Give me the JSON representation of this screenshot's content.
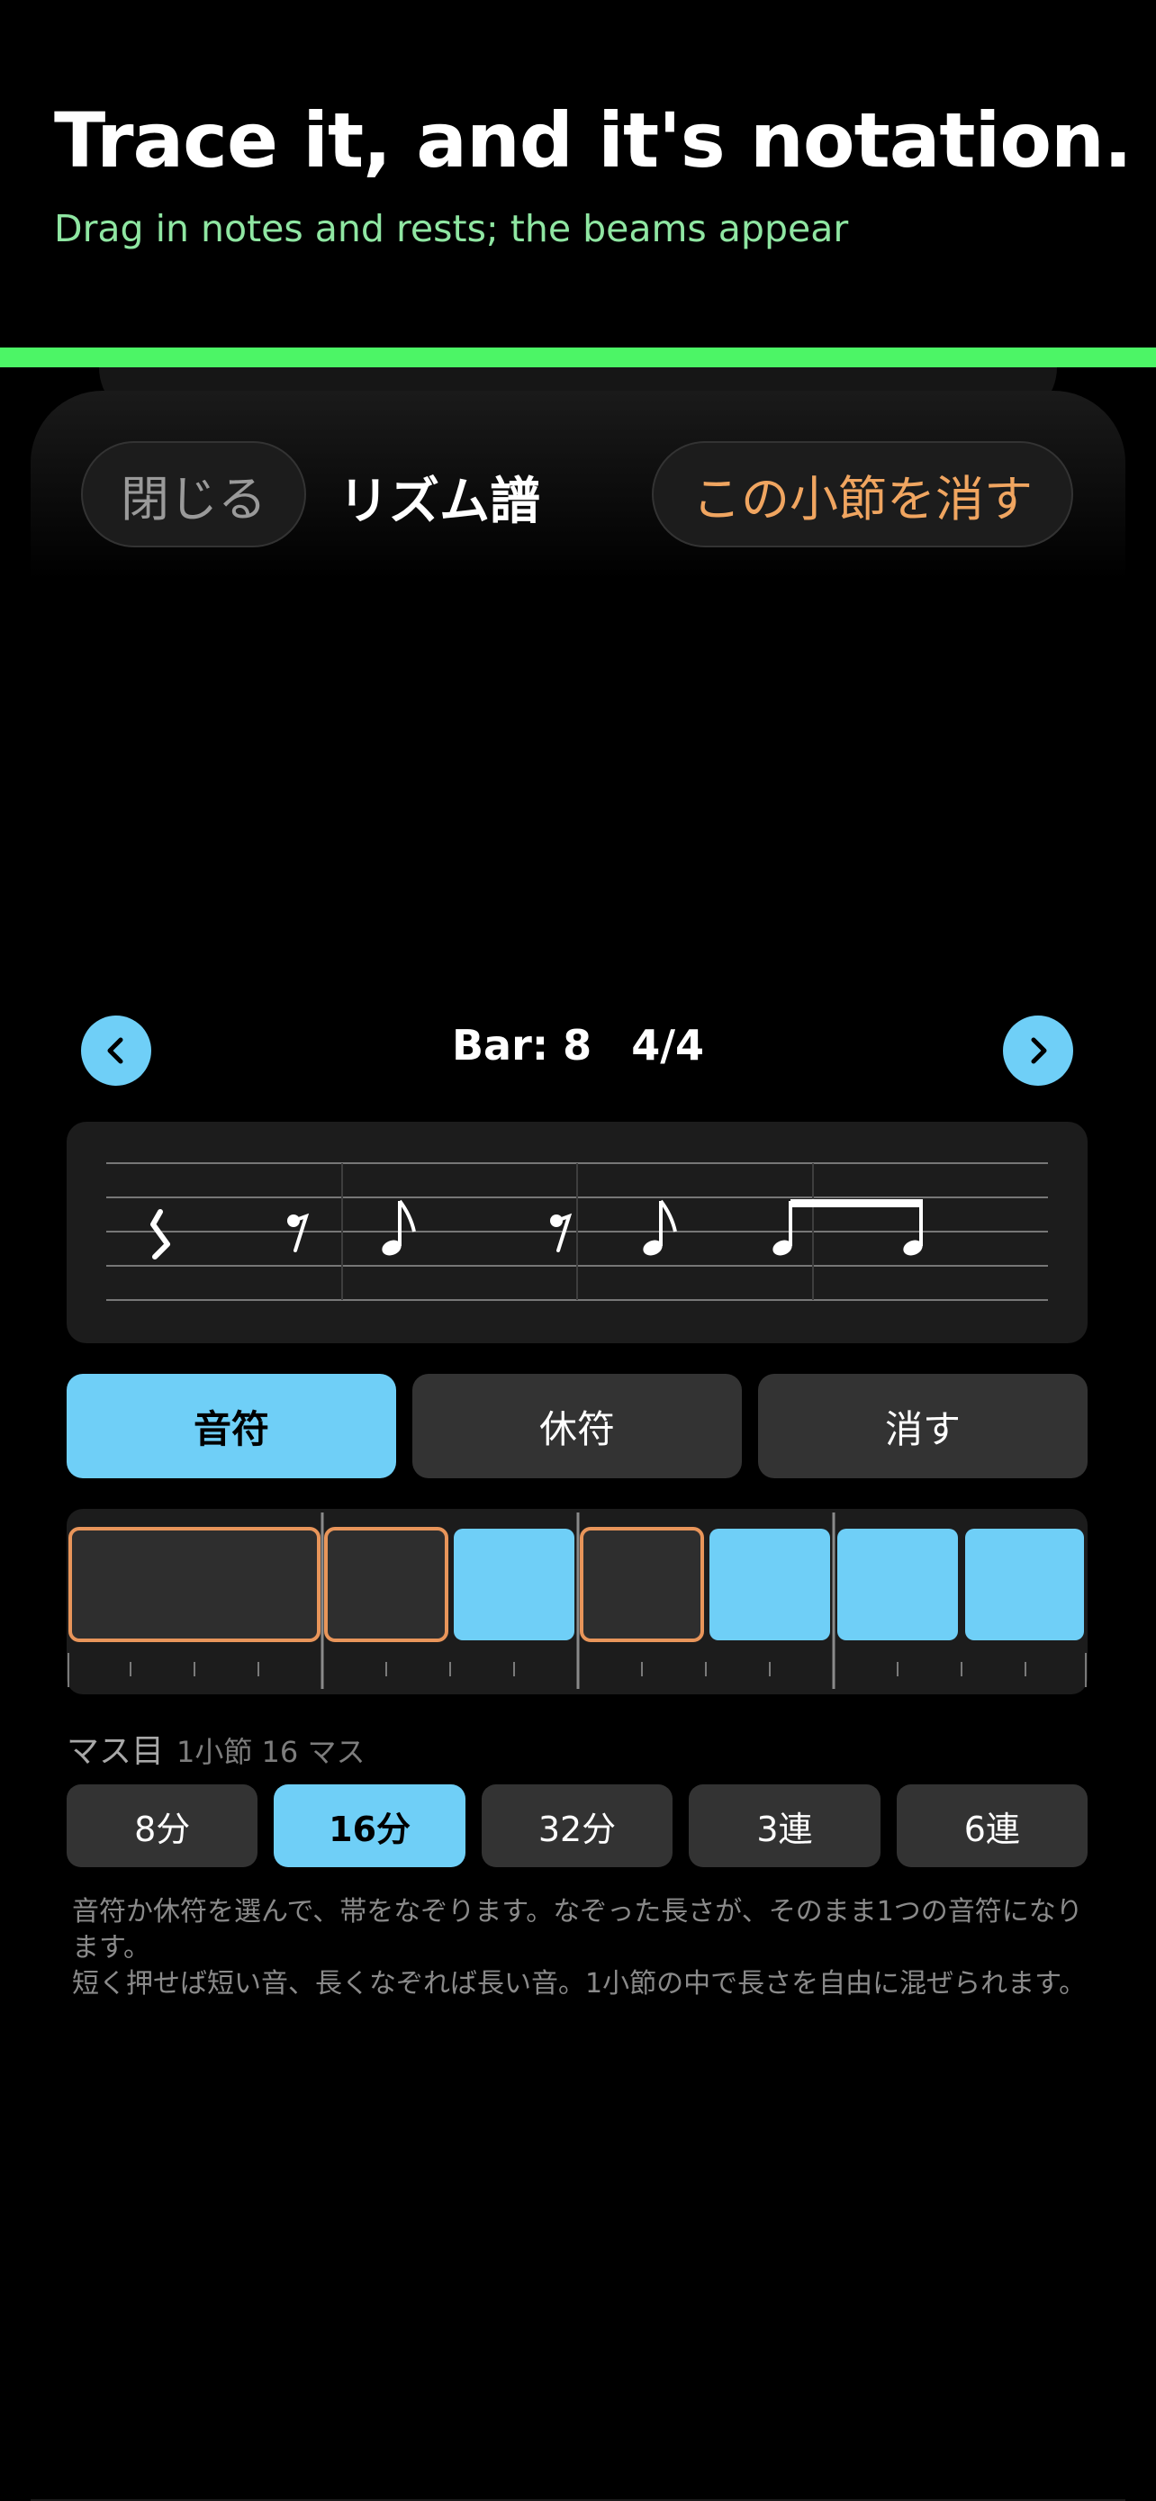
{
  "hero": {
    "title": "Trace it, and it's notation.",
    "subtitle": "Drag in notes and rests; the beams appear"
  },
  "header": {
    "close_label": "閉じる",
    "title": "リズム譜",
    "clear_label": "この小節を消す"
  },
  "bar_nav": {
    "bar_text": "Bar: 8",
    "time_signature": "4/4",
    "prev_icon": "chevron-left-icon",
    "next_icon": "chevron-right-icon"
  },
  "staff": {
    "events": [
      "quarter-rest",
      "eighth-rest",
      "eighth-note",
      "eighth-rest",
      "eighth-note",
      "beamed-eighth-pair"
    ]
  },
  "modes": [
    {
      "label": "音符",
      "active": true
    },
    {
      "label": "休符",
      "active": false
    },
    {
      "label": "消す",
      "active": false
    }
  ],
  "grid": {
    "caption": "マス目",
    "caption_sub": "1小節 16 マス",
    "steps_per_bar": 16,
    "cells": [
      {
        "type": "rest",
        "span": 4
      },
      {
        "type": "rest",
        "span": 2
      },
      {
        "type": "note",
        "span": 2
      },
      {
        "type": "rest",
        "span": 2
      },
      {
        "type": "note",
        "span": 2
      },
      {
        "type": "note",
        "span": 2
      },
      {
        "type": "note",
        "span": 2
      }
    ]
  },
  "resolutions": [
    {
      "label": "8分",
      "active": false
    },
    {
      "label": "16分",
      "active": true
    },
    {
      "label": "32分",
      "active": false
    },
    {
      "label": "3連",
      "active": false
    },
    {
      "label": "6連",
      "active": false
    }
  ],
  "help": {
    "line1": "音符か休符を選んで、帯をなぞります。なぞった長さが、そのまま1つの音符になります。",
    "line2": "短く押せば短い音、長くなぞれば長い音。1小節の中で長さを自由に混ぜられます。"
  },
  "colors": {
    "accent_green": "#4cf566",
    "subtitle_green": "#8fe6a2",
    "note_blue": "#6fcff7",
    "rest_orange": "#e8955a",
    "clear_orange": "#f0a560"
  }
}
